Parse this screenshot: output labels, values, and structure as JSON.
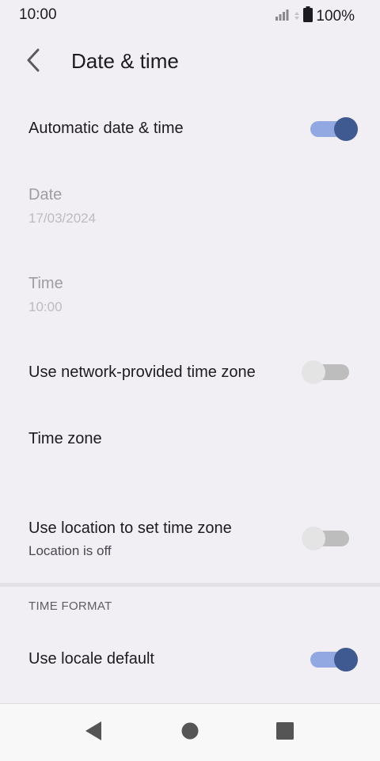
{
  "status_bar": {
    "time": "10:00",
    "battery_percent": "100%",
    "icons": [
      "signal-icon",
      "data-arrows-icon",
      "battery-icon"
    ]
  },
  "header": {
    "back_icon": "back-arrow-icon",
    "title": "Date & time"
  },
  "settings": {
    "automatic_date_time": {
      "title": "Automatic date & time",
      "enabled": true
    },
    "date": {
      "title": "Date",
      "value": "17/03/2024",
      "disabled": true
    },
    "time": {
      "title": "Time",
      "value": "10:00",
      "disabled": true
    },
    "network_time_zone": {
      "title": "Use network-provided time zone",
      "enabled": false
    },
    "time_zone": {
      "title": "Time zone"
    },
    "location_time_zone": {
      "title": "Use location to set time zone",
      "summary": "Location is off",
      "enabled": false
    }
  },
  "time_format": {
    "header": "TIME FORMAT",
    "use_locale_default": {
      "title": "Use locale default",
      "enabled": true
    }
  },
  "nav_bar": {
    "icons": [
      "nav-back-icon",
      "nav-home-icon",
      "nav-recents-icon"
    ]
  },
  "colors": {
    "background": "#f1eff3",
    "switch_on_track": "#92a8e2",
    "switch_on_thumb": "#3e5a90",
    "switch_off_track": "#bdbdbd",
    "switch_off_thumb": "#e4e4e4"
  }
}
